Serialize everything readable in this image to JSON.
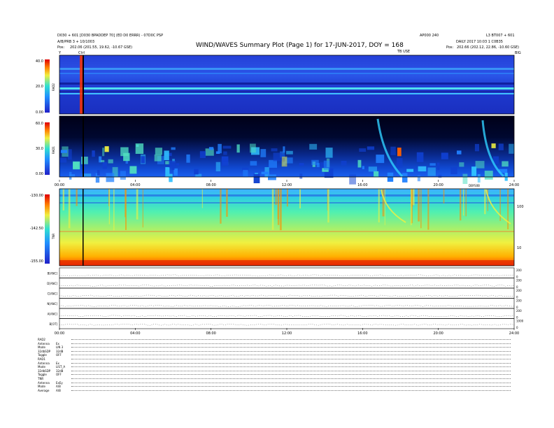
{
  "header": {
    "left_line1": "D030 + 601 [D030 BPADDEP 70] (ED D0 ERRR) - 07D0C PSP",
    "left_line2": "A/B/PRB 3 + 10/1003",
    "left_line3": "Pos:",
    "left_line3_values": "202.06 (201.55, 19.62, -10.67 GSE)",
    "title": "WIND/WAVES Summary Plot (Page 1) for 17-JUN-2017, DOY = 168",
    "right_top_a": "AP000 240",
    "right_top_b": "L3 BT007 + 601",
    "right_line2": "DAILY 2017 10:03 1 C0B35",
    "right_pos_label": "Pos:",
    "right_pos_values": "202.66 (202.12, 22.86, -10.60 GSE)",
    "marker_top": "Ctrl",
    "marker_right": "TB USE",
    "corner_tl": "Y",
    "corner_tr": "BIG"
  },
  "chart_data": [
    {
      "type": "heatmap",
      "name": "RAD2",
      "ylabel": "RAD2",
      "ylim": [
        0,
        40
      ],
      "yticks": [
        "40.0",
        "20.0",
        "0.00"
      ],
      "xlim": [
        0,
        24
      ],
      "colors": [
        "#2020c8",
        "#3050e8",
        "#40a0ff",
        "#30e0e0",
        "#f0f040",
        "#ff8000",
        "#e00000"
      ]
    },
    {
      "type": "heatmap",
      "name": "RAD1",
      "ylabel": "RAD1",
      "ylim": [
        0,
        60
      ],
      "yticks": [
        "60.0",
        "30.0",
        "0.00"
      ],
      "xlim": [
        0,
        24
      ],
      "xticks": [
        "00:00",
        "04:00",
        "08:00",
        "12:00",
        "16:00",
        "20:00",
        "24:00"
      ],
      "event_label": "DBYS0B",
      "colors": [
        "#000020",
        "#1030a0",
        "#2060ff",
        "#30c0ff",
        "#60ffa0",
        "#f0f040",
        "#ff6000"
      ]
    },
    {
      "type": "heatmap",
      "name": "TNR",
      "ylabel": "TNR",
      "ylim": [
        -155,
        -130
      ],
      "yticks": [
        "-130.00",
        "-142.50",
        "-155.00"
      ],
      "right_ticks": [
        "100",
        "10"
      ],
      "xlim": [
        0,
        24
      ],
      "colors": [
        "#30c0ff",
        "#50f0c0",
        "#a0f080",
        "#f0f040",
        "#ffc000",
        "#ff6000",
        "#d00000"
      ]
    },
    {
      "type": "line",
      "name": "auxiliary",
      "strips": [
        {
          "label": "B[ANC]",
          "right": [
            "200",
            "0"
          ]
        },
        {
          "label": "D[ANC]",
          "right": [
            "200",
            "0"
          ]
        },
        {
          "label": "C[ANC]",
          "right": [
            "200",
            "0"
          ]
        },
        {
          "label": "N[ANC]",
          "right": [
            "200",
            "0"
          ]
        },
        {
          "label": "A[ANC]",
          "right": [
            "200",
            "0"
          ]
        },
        {
          "label": "B[OT]",
          "right": [
            "1000",
            "0"
          ]
        }
      ],
      "xticks": [
        "00:00",
        "04:00",
        "08:00",
        "12:00",
        "16:00",
        "20:00",
        "24:00"
      ]
    }
  ],
  "config_table": [
    {
      "label": "RAD2",
      "value": ""
    },
    {
      "label": "Antenna",
      "value": "Ex"
    },
    {
      "label": "Mode",
      "value": "LIN 3"
    },
    {
      "label": "32dbSDP",
      "value": "32dB"
    },
    {
      "label": "Toggle",
      "value": "OFF"
    },
    {
      "label": "RAD1",
      "value": ""
    },
    {
      "label": "Antenna",
      "value": "Ex"
    },
    {
      "label": "Mode",
      "value": "LIST_A"
    },
    {
      "label": "32dbSDP",
      "value": "32dB"
    },
    {
      "label": "Toggle",
      "value": "OFF"
    },
    {
      "label": "TNR",
      "value": ""
    },
    {
      "label": "Antenna",
      "value": "ExEy"
    },
    {
      "label": "Mode",
      "value": "A/B"
    },
    {
      "label": "Average",
      "value": "A/B"
    }
  ]
}
